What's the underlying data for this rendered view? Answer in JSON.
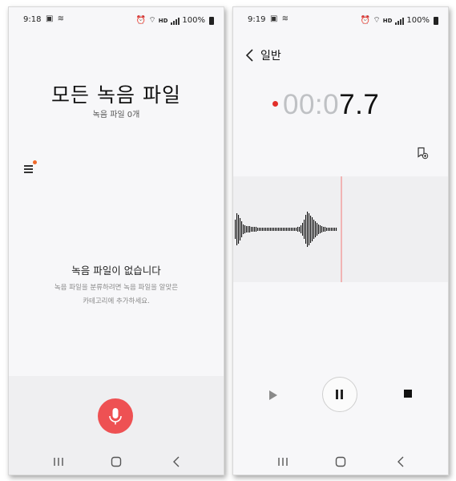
{
  "left": {
    "status": {
      "time": "9:18",
      "battery": "100%",
      "net": "HD"
    },
    "title": "모든 녹음 파일",
    "count": "녹음 파일 0개",
    "empty_title": "녹음 파일이 없습니다",
    "empty_desc_line1": "녹음 파일을 분류하려면 녹음 파일을 알맞은",
    "empty_desc_line2": "카테고리에 추가하세요.",
    "accent_color": "#ee5153"
  },
  "right": {
    "status": {
      "time": "9:19",
      "battery": "100%",
      "net": "HD"
    },
    "header_title": "일반",
    "timer_dim": "00:0",
    "timer_bright": "7.7",
    "recording_dot_color": "#e22f2a",
    "playhead_color": "#f2a0a0"
  },
  "icons": [
    "menu-icon",
    "microphone-icon",
    "back-icon",
    "bookmark-icon",
    "play-icon",
    "pause-icon",
    "stop-icon",
    "recents-icon",
    "home-icon",
    "nav-back-icon"
  ]
}
